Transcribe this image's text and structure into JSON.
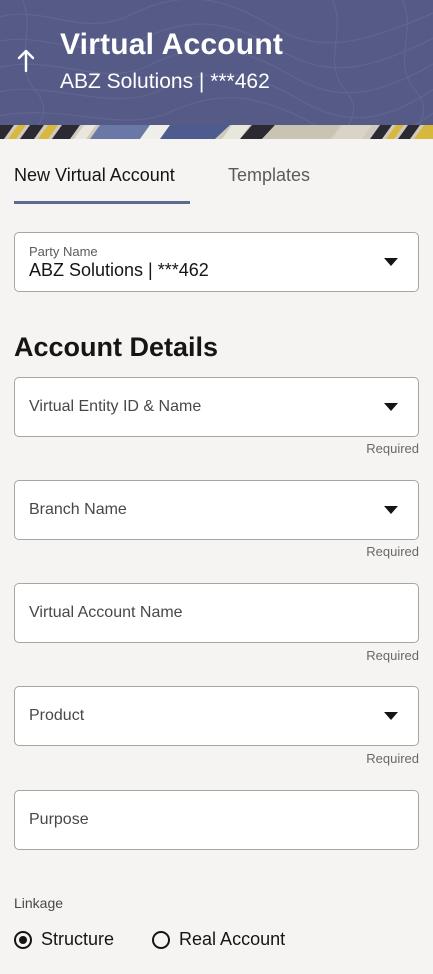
{
  "header": {
    "title": "Virtual Account",
    "subtitle": "ABZ Solutions | ***462",
    "back_icon": "arrow-up-icon",
    "background_color": "#555b86"
  },
  "tabs": [
    {
      "label": "New Virtual Account",
      "active": true
    },
    {
      "label": "Templates",
      "active": false
    }
  ],
  "party": {
    "label": "Party Name",
    "value": "ABZ Solutions | ***462"
  },
  "section_title": "Account Details",
  "fields": [
    {
      "label": "Virtual Entity ID & Name",
      "type": "dropdown",
      "helper": "Required"
    },
    {
      "label": "Branch Name",
      "type": "dropdown",
      "helper": "Required"
    },
    {
      "label": "Virtual Account Name",
      "type": "text",
      "helper": "Required"
    },
    {
      "label": "Product",
      "type": "dropdown",
      "helper": "Required"
    },
    {
      "label": "Purpose",
      "type": "text"
    }
  ],
  "linkage": {
    "label": "Linkage",
    "options": [
      {
        "label": "Structure",
        "selected": true
      },
      {
        "label": "Real Account",
        "selected": false
      }
    ]
  },
  "colors": {
    "accent": "#5b6a8e",
    "page_background": "#f5f4f2"
  }
}
